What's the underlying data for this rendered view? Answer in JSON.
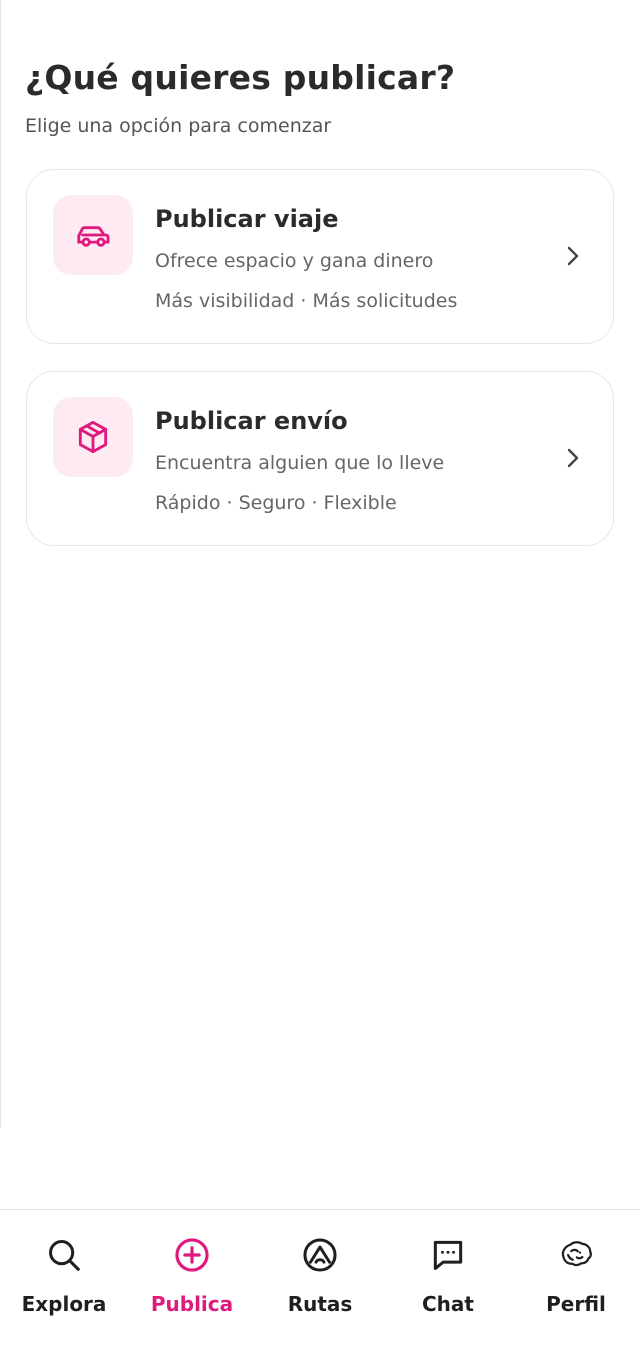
{
  "header": {
    "title": "¿Qué quieres publicar?",
    "subtitle": "Elige una opción para comenzar"
  },
  "options": [
    {
      "title": "Publicar viaje",
      "description": "Ofrece espacio y gana dinero",
      "meta": "Más visibilidad · Más solicitudes",
      "icon": "car-icon"
    },
    {
      "title": "Publicar envío",
      "description": "Encuentra alguien que lo lleve",
      "meta": "Rápido · Seguro · Flexible",
      "icon": "package-icon"
    }
  ],
  "tabs": [
    {
      "label": "Explora",
      "icon": "search-icon",
      "active": false
    },
    {
      "label": "Publica",
      "icon": "plus-circle-icon",
      "active": true
    },
    {
      "label": "Rutas",
      "icon": "route-icon",
      "active": false
    },
    {
      "label": "Chat",
      "icon": "chat-icon",
      "active": false
    },
    {
      "label": "Perfil",
      "icon": "lion-avatar-icon",
      "active": false
    }
  ],
  "colors": {
    "accent": "#e0197f",
    "icon_tile_bg": "#fdeaf3",
    "text_primary": "#2b2b2b",
    "text_secondary": "#666666",
    "card_border": "#e7e7e7"
  }
}
